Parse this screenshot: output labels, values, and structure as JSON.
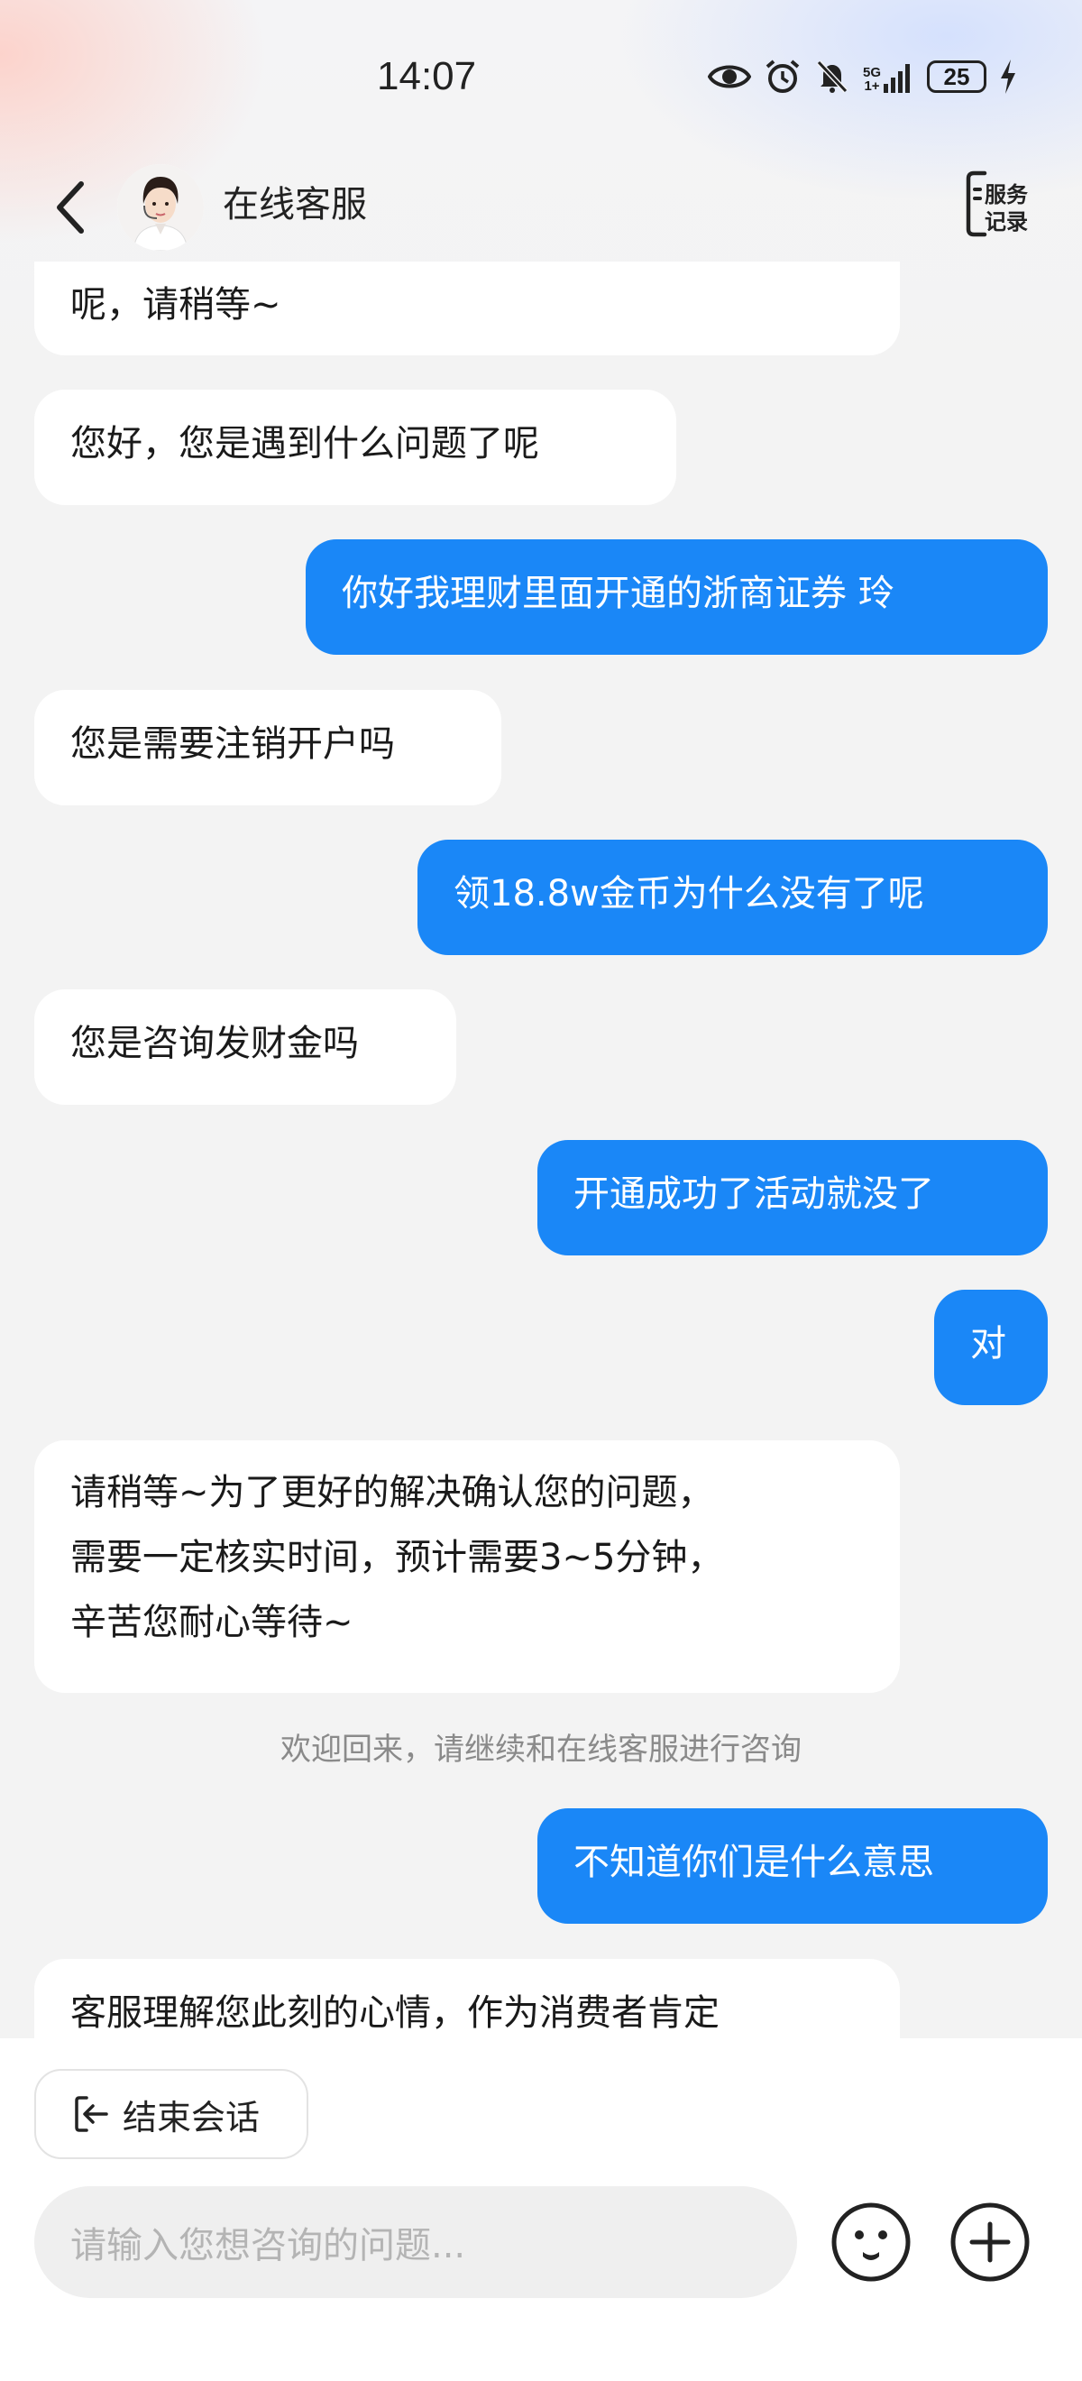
{
  "status_bar": {
    "time": "14:07",
    "network": "5G",
    "network_sub": "1+",
    "battery": "25",
    "icons": [
      "eye-icon",
      "alarm-icon",
      "mute-icon",
      "signal-icon",
      "battery-icon",
      "charging-icon"
    ]
  },
  "header": {
    "title": "在线客服",
    "service_record_line1": "服务",
    "service_record_line2": "记录"
  },
  "messages": [
    {
      "side": "left",
      "text": "呢，请稍等~"
    },
    {
      "side": "left",
      "text": "您好，您是遇到什么问题了呢"
    },
    {
      "side": "right",
      "text": "你好我理财里面开通的浙商证券 玲"
    },
    {
      "side": "left",
      "text": "您是需要注销开户吗"
    },
    {
      "side": "right",
      "text": "领18.8w金币为什么没有了呢"
    },
    {
      "side": "left",
      "text": "您是咨询发财金吗"
    },
    {
      "side": "right",
      "text": "开通成功了活动就没了"
    },
    {
      "side": "right",
      "text": "对"
    },
    {
      "side": "left",
      "lines": [
        "请稍等~为了更好的解决确认您的问题，",
        "需要一定核实时间，预计需要3~5分钟，",
        "辛苦您耐心等待~"
      ]
    },
    {
      "side": "notice",
      "text": "欢迎回来，请继续和在线客服进行咨询"
    },
    {
      "side": "right",
      "text": "不知道你们是什么意思"
    },
    {
      "side": "left",
      "text": "客服理解您此刻的心情，作为消费者肯定"
    }
  ],
  "bottom": {
    "end_session_label": "结束会话",
    "input_placeholder": "请输入您想咨询的问题..."
  },
  "colors": {
    "accent": "#1a87f7",
    "bubble_left": "#ffffff",
    "background": "#f3f3f3"
  }
}
